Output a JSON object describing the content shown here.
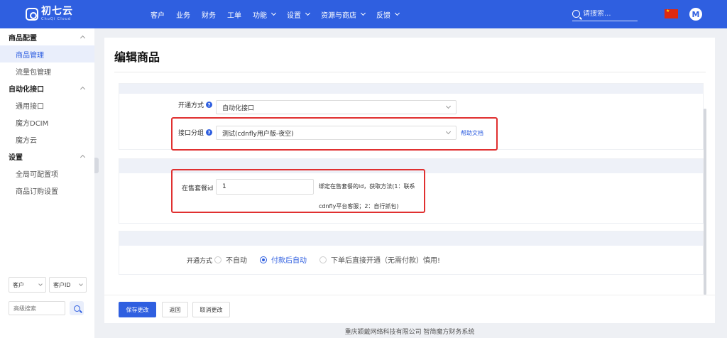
{
  "header": {
    "logo_name": "初七云",
    "logo_sub": "ChuQi Cloud",
    "nav": [
      {
        "label": "客户",
        "dropdown": false
      },
      {
        "label": "业务",
        "dropdown": false
      },
      {
        "label": "财务",
        "dropdown": false
      },
      {
        "label": "工单",
        "dropdown": false
      },
      {
        "label": "功能",
        "dropdown": true
      },
      {
        "label": "设置",
        "dropdown": true
      },
      {
        "label": "资源与商店",
        "dropdown": true
      },
      {
        "label": "反馈",
        "dropdown": true
      }
    ],
    "search_placeholder": "请搜索...",
    "avatar_letter": "M"
  },
  "sidebar": {
    "groups": [
      {
        "title": "商品配置",
        "items": [
          "商品管理",
          "流量包管理"
        ]
      },
      {
        "title": "自动化接口",
        "items": [
          "通用接口",
          "魔方DCIM",
          "魔方云"
        ]
      },
      {
        "title": "设置",
        "items": [
          "全局可配置项",
          "商品订购设置"
        ]
      }
    ],
    "active_item": "商品管理",
    "filter_select_1": "客户",
    "filter_select_2": "客户ID",
    "advanced_search_placeholder": "高级搜索"
  },
  "main": {
    "title": "编辑商品",
    "section1": {
      "open_mode_label": "开通方式",
      "open_mode_value": "自动化接口",
      "api_group_label": "接口分组",
      "api_group_value": "测试(cdnfly用户版-夜空)",
      "help_doc_link": "帮助文档"
    },
    "section2": {
      "package_id_label": "在售套餐id",
      "package_id_value": "1",
      "package_id_hint": "绑定在售套餐的id，获取方法(1：联系cdnfly平台客服；2：自行抓包)"
    },
    "section3": {
      "open_mode_label": "开通方式",
      "options": [
        "不自动",
        "付款后自动",
        "下单后直接开通（无需付款）慎用!"
      ],
      "selected": "付款后自动"
    },
    "buttons": {
      "save": "保存更改",
      "back": "返回",
      "cancel": "取消更改"
    }
  },
  "footer": {
    "copyright": "重庆颖戴网络科技有限公司 智简魔方财务系统"
  },
  "colors": {
    "primary": "#2f5fe0",
    "highlight_box": "#e03030"
  }
}
